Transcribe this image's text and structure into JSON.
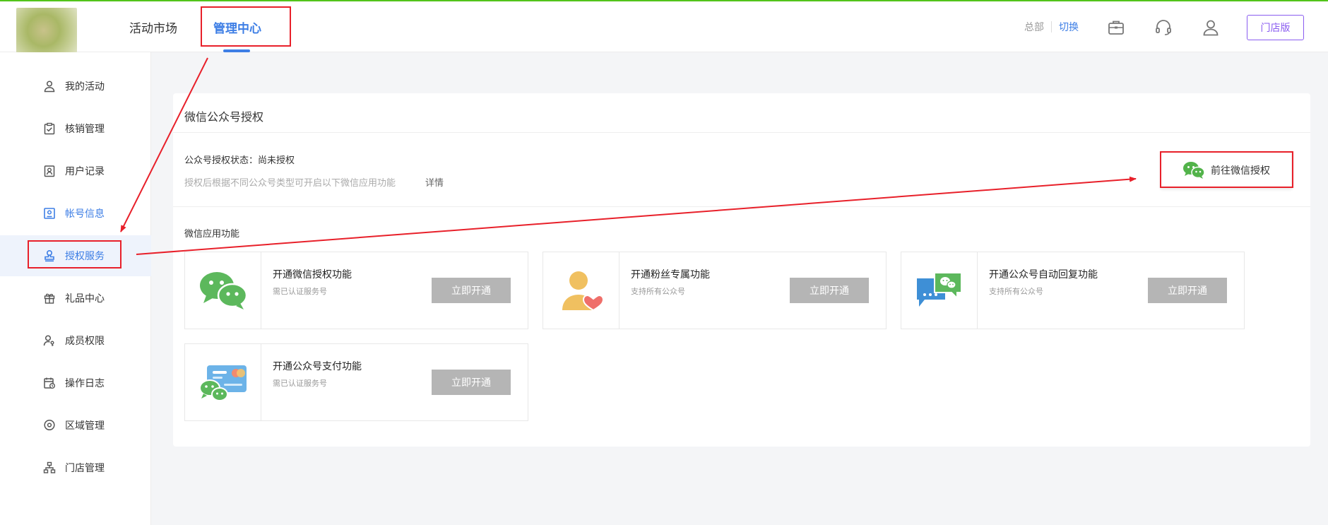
{
  "header": {
    "nav": [
      {
        "label": "活动市场"
      },
      {
        "label": "管理中心"
      }
    ],
    "switch": {
      "hq_label": "总部",
      "switch_label": "切换"
    },
    "icons": [
      "briefcase-icon",
      "headset-icon",
      "user-icon"
    ],
    "store_button": "门店版"
  },
  "sidebar": {
    "items": [
      {
        "label": "我的活动",
        "icon": "person-icon"
      },
      {
        "label": "核销管理",
        "icon": "clipboard-check-icon"
      },
      {
        "label": "用户记录",
        "icon": "user-record-icon"
      },
      {
        "label": "帐号信息",
        "icon": "id-card-icon"
      },
      {
        "label": "授权服务",
        "icon": "stamp-icon"
      },
      {
        "label": "礼品中心",
        "icon": "gift-icon"
      },
      {
        "label": "成员权限",
        "icon": "member-key-icon"
      },
      {
        "label": "操作日志",
        "icon": "calendar-log-icon"
      },
      {
        "label": "区域管理",
        "icon": "location-icon"
      },
      {
        "label": "门店管理",
        "icon": "org-tree-icon"
      }
    ]
  },
  "main": {
    "title": "微信公众号授权",
    "status": "公众号授权状态：尚未授权",
    "hint": "授权后根据不同公众号类型可开启以下微信应用功能",
    "detail_link": "详情",
    "auth_button": "前往微信授权",
    "section_label": "微信应用功能",
    "features": [
      {
        "title": "开通微信授权功能",
        "subtitle": "需已认证服务号",
        "button": "立即开通",
        "icon": "wechat-icon"
      },
      {
        "title": "开通粉丝专属功能",
        "subtitle": "支持所有公众号",
        "button": "立即开通",
        "icon": "fan-heart-icon"
      },
      {
        "title": "开通公众号自动回复功能",
        "subtitle": "支持所有公众号",
        "button": "立即开通",
        "icon": "auto-reply-icon"
      },
      {
        "title": "开通公众号支付功能",
        "subtitle": "需已认证服务号",
        "button": "立即开通",
        "icon": "wechat-pay-card-icon"
      }
    ]
  },
  "colors": {
    "accent": "#3d7ee5",
    "wechat_green": "#52b34a",
    "annotation_red": "#e8202a",
    "store_purple": "#8a5cf0",
    "disabled_button": "#b5b5b5"
  }
}
